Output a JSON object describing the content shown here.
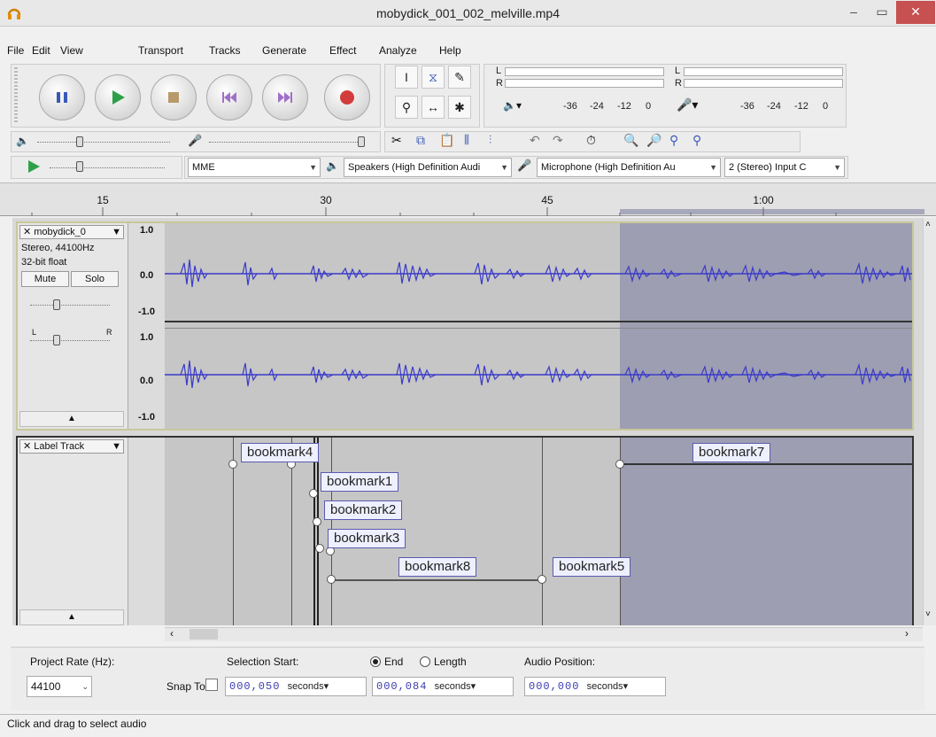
{
  "window": {
    "title": "mobydick_001_002_melville.mp4"
  },
  "menu": [
    "File",
    "Edit",
    "View",
    "Transport",
    "Tracks",
    "Generate",
    "Effect",
    "Analyze",
    "Help"
  ],
  "meters": {
    "play_ticks": [
      "-36",
      "-24",
      "-12",
      "0"
    ],
    "rec_ticks": [
      "-36",
      "-24",
      "-12",
      "0"
    ],
    "channel_l": "L",
    "channel_r": "R"
  },
  "device": {
    "host": "MME",
    "speakers": "Speakers (High Definition Audi",
    "microphone": "Microphone (High Definition Au",
    "channels": "2 (Stereo) Input C"
  },
  "ruler": {
    "ticks": [
      "15",
      "30",
      "45",
      "1:00"
    ]
  },
  "audio_track": {
    "name": "mobydick_0",
    "format": "Stereo, 44100Hz",
    "depth": "32-bit float",
    "mute": "Mute",
    "solo": "Solo",
    "pan_left": "L",
    "pan_right": "R",
    "scale_top": "1.0",
    "scale_mid": "0.0",
    "scale_bot": "-1.0",
    "scale2_top": "1.0",
    "scale2_mid": "0.0",
    "scale2_bot": "-1.0"
  },
  "label_track": {
    "name": "Label Track",
    "labels": [
      "bookmark4",
      "bookmark1",
      "bookmark2",
      "bookmark3",
      "bookmark8",
      "bookmark5",
      "bookmark7"
    ]
  },
  "selection_bar": {
    "rate_label": "Project Rate (Hz):",
    "rate_value": "44100",
    "snap_label": "Snap To",
    "sel_start_label": "Selection Start:",
    "end_label": "End",
    "length_label": "Length",
    "start_value": "000,050",
    "end_value": "000,084",
    "unit": "seconds",
    "audio_pos_label": "Audio Position:",
    "audio_pos_value": "000,000"
  },
  "status": {
    "text": "Click and drag to select audio"
  },
  "colors": {
    "waveform": "#3a3ac8",
    "selection": "#a0a0b8",
    "track_bg": "#c4c4c4"
  }
}
